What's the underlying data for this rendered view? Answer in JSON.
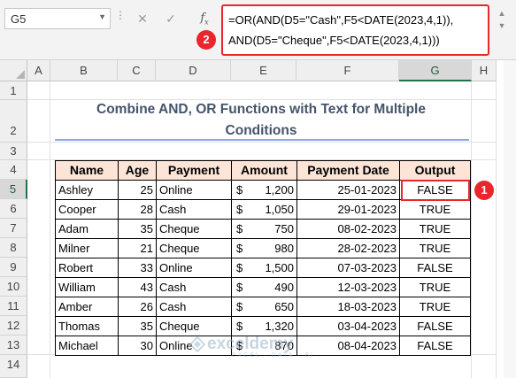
{
  "formula_bar": {
    "name_box": "G5",
    "cancel_icon": "✕",
    "enter_icon": "✓",
    "fx_label": "f",
    "fx_sub": "x",
    "formula_line1": "=OR(AND(D5=\"Cash\",F5<DATE(2023,4,1)),",
    "formula_line2": "AND(D5=\"Cheque\",F5<DATE(2023,4,1)))"
  },
  "callouts": {
    "formula_marker": "2",
    "cell_marker": "1",
    "color": "#e8262c"
  },
  "columns": [
    "A",
    "B",
    "C",
    "D",
    "E",
    "F",
    "G",
    "H"
  ],
  "rows": [
    "1",
    "2",
    "3",
    "4",
    "5",
    "6",
    "7",
    "8",
    "9",
    "10",
    "11",
    "12",
    "13",
    "14"
  ],
  "title_line1": "Combine AND, OR Functions with Text for Multiple",
  "title_line2": "Conditions",
  "table": {
    "headers": [
      "Name",
      "Age",
      "Payment",
      "Amount",
      "Payment Date",
      "Output"
    ],
    "currency": "$",
    "rows": [
      [
        "Ashley",
        "25",
        "Online",
        "1,200",
        "25-01-2023",
        "FALSE"
      ],
      [
        "Cooper",
        "28",
        "Cash",
        "1,050",
        "29-01-2023",
        "TRUE"
      ],
      [
        "Adam",
        "35",
        "Cheque",
        "750",
        "08-02-2023",
        "TRUE"
      ],
      [
        "Milner",
        "21",
        "Cheque",
        "980",
        "28-02-2023",
        "TRUE"
      ],
      [
        "Robert",
        "33",
        "Online",
        "1,500",
        "07-03-2023",
        "FALSE"
      ],
      [
        "William",
        "43",
        "Cash",
        "490",
        "12-03-2023",
        "TRUE"
      ],
      [
        "Amber",
        "26",
        "Cash",
        "650",
        "18-03-2023",
        "TRUE"
      ],
      [
        "Thomas",
        "35",
        "Cheque",
        "1,320",
        "03-04-2023",
        "FALSE"
      ],
      [
        "Michael",
        "30",
        "Online",
        "870",
        "08-04-2023",
        "FALSE"
      ]
    ]
  },
  "watermark": {
    "name": "exceldemy",
    "tagline": "EXCEL · DATA · BI"
  },
  "colors": {
    "header_fill": "#fce4d6",
    "title": "#44546a",
    "selection": "#217346"
  }
}
